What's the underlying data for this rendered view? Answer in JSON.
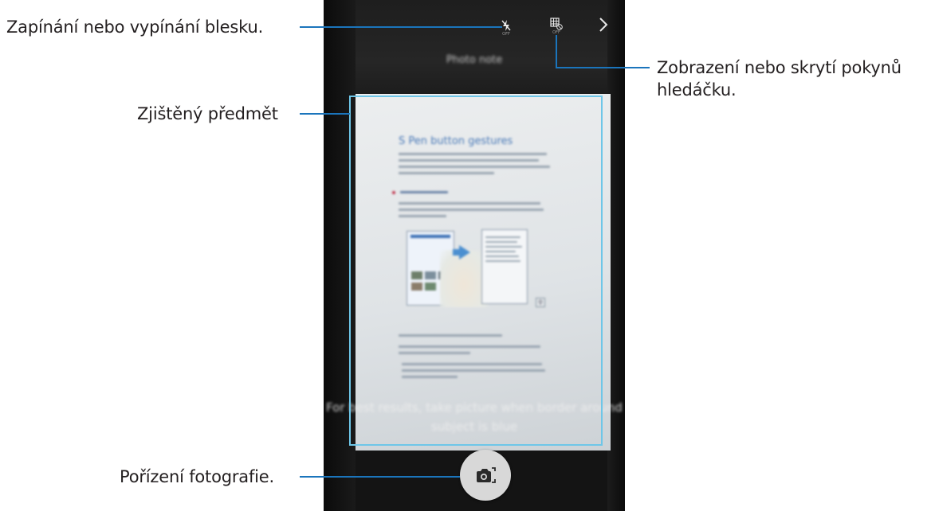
{
  "callouts": {
    "flash": "Zapínání nebo vypínání blesku.",
    "guide_line1": "Zobrazení nebo skrytí pokynů",
    "guide_line2": "hledáčku.",
    "detected": "Zjištěný předmět",
    "capture": "Pořízení fotografie."
  },
  "camera": {
    "flash_icon": "flash-off-icon",
    "flash_sub": "OFF",
    "guide_icon": "grid-off-icon",
    "guide_sub": "OFF",
    "next_icon": "chevron-right-icon",
    "mode_title": "Photo note",
    "hint": "For best results, take picture when border around subject is blue",
    "shutter_icon": "camera-capture-icon",
    "border_color": "#6ec6e8"
  },
  "document": {
    "heading": "S Pen button gestures"
  },
  "colors": {
    "callout_line": "#1b75bc",
    "callout_text": "#231f20"
  }
}
